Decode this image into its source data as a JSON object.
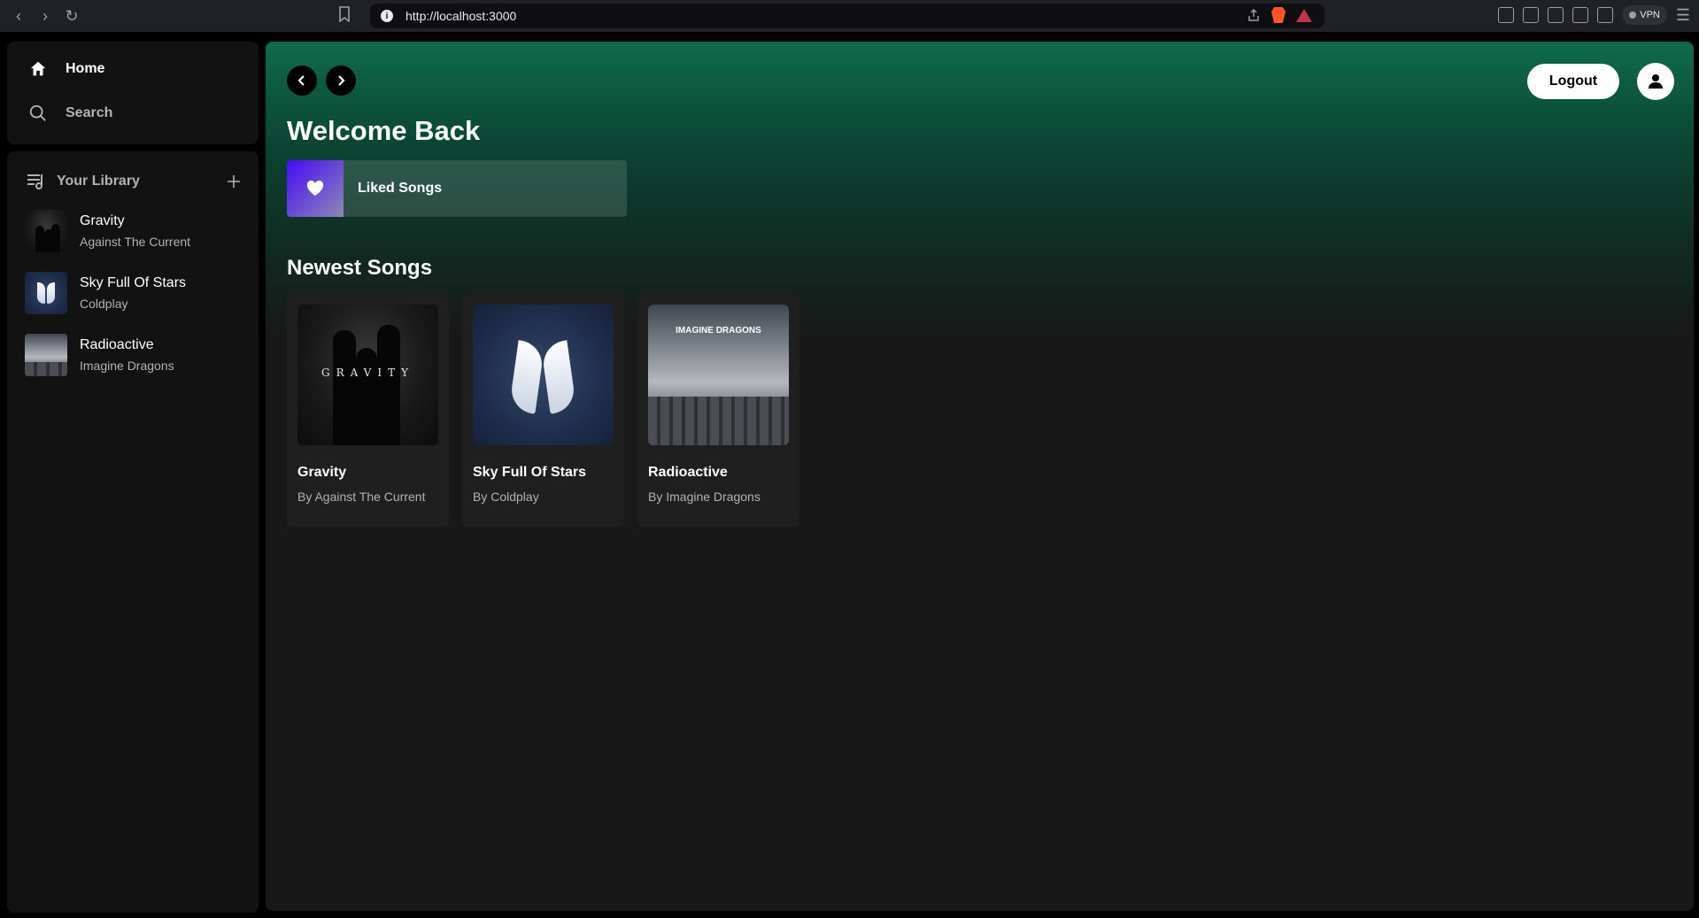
{
  "browser": {
    "url": "http://localhost:3000",
    "vpn_label": "VPN"
  },
  "sidebar": {
    "nav": [
      {
        "label": "Home"
      },
      {
        "label": "Search"
      }
    ],
    "library_title": "Your Library",
    "library": [
      {
        "title": "Gravity",
        "artist": "Against The Current"
      },
      {
        "title": "Sky Full Of Stars",
        "artist": "Coldplay"
      },
      {
        "title": "Radioactive",
        "artist": "Imagine Dragons"
      }
    ]
  },
  "main": {
    "logout_label": "Logout",
    "welcome": "Welcome Back",
    "liked_songs": "Liked Songs",
    "section_title": "Newest Songs",
    "album_art_text": {
      "gravity": "GRAVITY",
      "imagine": "IMAGINE DRAGONS"
    },
    "songs": [
      {
        "title": "Gravity",
        "byline": "By Against The Current"
      },
      {
        "title": "Sky Full Of Stars",
        "byline": "By Coldplay"
      },
      {
        "title": "Radioactive",
        "byline": "By Imagine Dragons"
      }
    ]
  },
  "colors": {
    "accent_gradient_top": "#0f6b4b",
    "background": "#181818",
    "liked_gradient": "#450af5"
  }
}
